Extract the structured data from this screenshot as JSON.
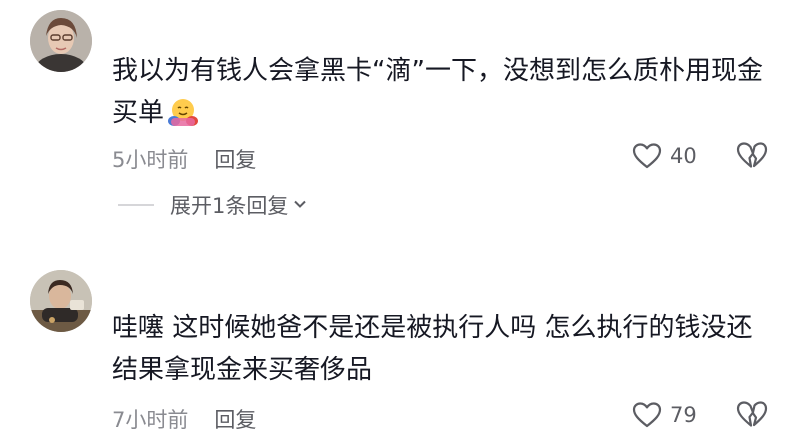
{
  "comments": [
    {
      "avatar": "avatar-woman-glasses",
      "text": "我以为有钱人会拿黑卡“滴”一下，没想到怎么质朴用现金买单",
      "emoji": "hugging-face-emoji",
      "time": "5小时前",
      "reply_label": "回复",
      "likes": "40"
    },
    {
      "avatar": "avatar-person-photo",
      "text": "哇噻 这时候她爸不是还是被执行人吗 怎么执行的钱没还 结果拿现金来买奢侈品",
      "time": "7小时前",
      "reply_label": "回复",
      "likes": "79"
    }
  ],
  "expand_replies": {
    "label": "展开1条回复"
  },
  "colors": {
    "text": "#161823",
    "meta": "#8a8b91",
    "icon": "#5c5d63"
  }
}
